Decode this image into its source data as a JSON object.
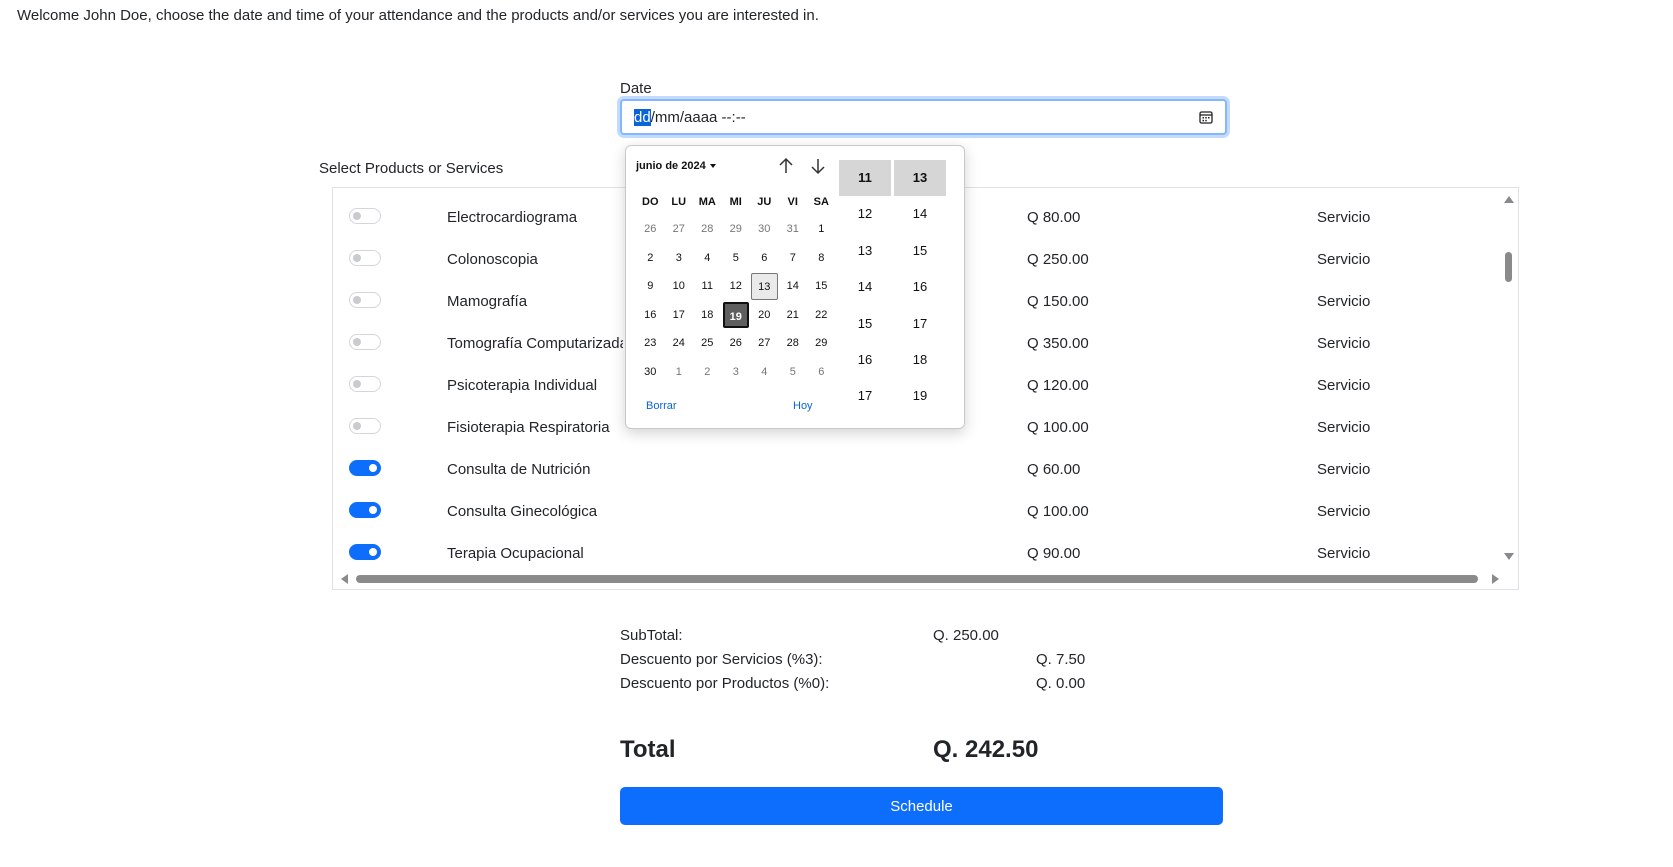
{
  "welcome": "Welcome John Doe, choose the date and time of your attendance and the products and/or services you are interested in.",
  "date": {
    "label": "Date",
    "value_selected": "dd",
    "value_rest": "/mm/aaaa --:--"
  },
  "products_label": "Select Products or Services",
  "rows": [
    {
      "name": "Electrocardiograma",
      "price": "Q 80.00",
      "type": "Servicio",
      "checked": false
    },
    {
      "name": "Colonoscopia",
      "price": "Q 250.00",
      "type": "Servicio",
      "checked": false
    },
    {
      "name": "Mamografía",
      "price": "Q 150.00",
      "type": "Servicio",
      "checked": false
    },
    {
      "name": "Tomografía Computarizada",
      "price": "Q 350.00",
      "type": "Servicio",
      "checked": false
    },
    {
      "name": "Psicoterapia Individual",
      "price": "Q 120.00",
      "type": "Servicio",
      "checked": false
    },
    {
      "name": "Fisioterapia Respiratoria",
      "price": "Q 100.00",
      "type": "Servicio",
      "checked": false
    },
    {
      "name": "Consulta de Nutrición",
      "price": "Q 60.00",
      "type": "Servicio",
      "checked": true
    },
    {
      "name": "Consulta Ginecológica",
      "price": "Q 100.00",
      "type": "Servicio",
      "checked": true
    },
    {
      "name": "Terapia Ocupacional",
      "price": "Q 90.00",
      "type": "Servicio",
      "checked": true
    }
  ],
  "calendar": {
    "month_label": "junio de 2024",
    "weekdays": [
      "DO",
      "LU",
      "MA",
      "MI",
      "JU",
      "VI",
      "SA"
    ],
    "days": [
      {
        "d": "26",
        "muted": true
      },
      {
        "d": "27",
        "muted": true
      },
      {
        "d": "28",
        "muted": true
      },
      {
        "d": "29",
        "muted": true
      },
      {
        "d": "30",
        "muted": true
      },
      {
        "d": "31",
        "muted": true
      },
      {
        "d": "1"
      },
      {
        "d": "2"
      },
      {
        "d": "3"
      },
      {
        "d": "4"
      },
      {
        "d": "5"
      },
      {
        "d": "6"
      },
      {
        "d": "7"
      },
      {
        "d": "8"
      },
      {
        "d": "9"
      },
      {
        "d": "10"
      },
      {
        "d": "11"
      },
      {
        "d": "12"
      },
      {
        "d": "13",
        "today": true
      },
      {
        "d": "14"
      },
      {
        "d": "15"
      },
      {
        "d": "16"
      },
      {
        "d": "17"
      },
      {
        "d": "18"
      },
      {
        "d": "19",
        "selected": true
      },
      {
        "d": "20"
      },
      {
        "d": "21"
      },
      {
        "d": "22"
      },
      {
        "d": "23"
      },
      {
        "d": "24"
      },
      {
        "d": "25"
      },
      {
        "d": "26"
      },
      {
        "d": "27"
      },
      {
        "d": "28"
      },
      {
        "d": "29"
      },
      {
        "d": "30"
      },
      {
        "d": "1",
        "muted": true
      },
      {
        "d": "2",
        "muted": true
      },
      {
        "d": "3",
        "muted": true
      },
      {
        "d": "4",
        "muted": true
      },
      {
        "d": "5",
        "muted": true
      },
      {
        "d": "6",
        "muted": true
      }
    ],
    "clear_label": "Borrar",
    "today_label": "Hoy",
    "hours": [
      "11",
      "12",
      "13",
      "14",
      "15",
      "16",
      "17"
    ],
    "minutes": [
      "13",
      "14",
      "15",
      "16",
      "17",
      "18",
      "19"
    ]
  },
  "summary": {
    "subtotal_label": "SubTotal:",
    "subtotal_value": "Q. 250.00",
    "disc_services_label": "Descuento por Servicios (%3):",
    "disc_services_value": "Q. 7.50",
    "disc_products_label": "Descuento por Productos (%0):",
    "disc_products_value": "Q. 0.00",
    "total_label": "Total",
    "total_value": "Q. 242.50"
  },
  "schedule_label": "Schedule",
  "colors": {
    "primary": "#0d6efd",
    "selected_day": "#5f5f5f"
  }
}
